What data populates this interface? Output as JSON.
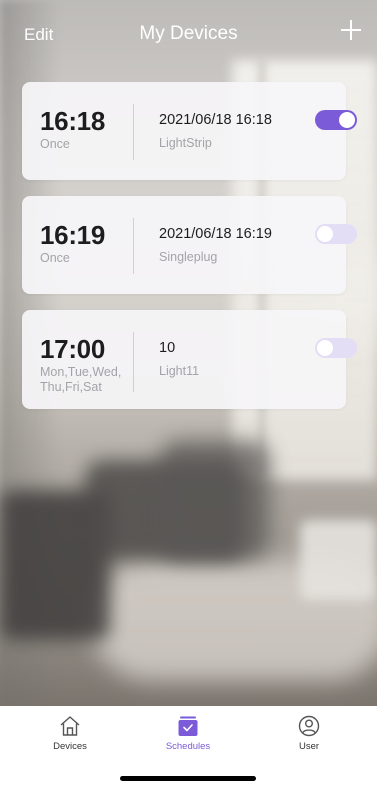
{
  "header": {
    "edit_label": "Edit",
    "title": "My Devices",
    "add_icon": "plus-icon"
  },
  "schedules": [
    {
      "time": "16:18",
      "repeat": "Once",
      "datetime": "2021/06/18 16:18",
      "device": "LightStrip",
      "enabled": true
    },
    {
      "time": "16:19",
      "repeat": "Once",
      "datetime": "2021/06/18 16:19",
      "device": "Singleplug",
      "enabled": false
    },
    {
      "time": "17:00",
      "repeat": "Mon,Tue,Wed, Thu,Fri,Sat",
      "datetime": "10",
      "device": "Light11",
      "enabled": false
    }
  ],
  "tabbar": {
    "tabs": [
      {
        "label": "Devices",
        "icon": "home-icon",
        "active": false
      },
      {
        "label": "Schedules",
        "icon": "calendar-icon",
        "active": true
      },
      {
        "label": "User",
        "icon": "user-icon",
        "active": false
      }
    ]
  },
  "colors": {
    "accent": "#7b5bd8",
    "toggle_off": "#e3ddf6",
    "card_bg": "#f6f5f8",
    "secondary_text": "#a3a3a8"
  }
}
